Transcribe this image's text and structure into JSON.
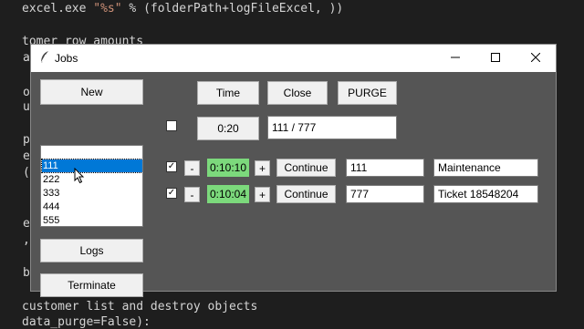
{
  "editor": {
    "line1_pre": "excel.exe ",
    "line1_str": "\"%s\"",
    "line1_post": " % (folderPath+logFileExcel, ))",
    "line2": "tomer row amounts",
    "line3": "customer list and destroy objects",
    "line4": "data_purge=False):",
    "gutter": [
      "a",
      "o",
      "u",
      "p",
      "e",
      "(",
      "e",
      ",",
      "b"
    ]
  },
  "window": {
    "title": "Jobs",
    "icon": "feather-icon",
    "controls": [
      "minimize-icon",
      "maximize-icon",
      "close-icon"
    ]
  },
  "toolbar": {
    "new_label": "New",
    "time_label": "Time",
    "close_label": "Close",
    "purge_label": "PURGE",
    "logs_label": "Logs",
    "terminate_label": "Terminate"
  },
  "listbox": {
    "items": [
      "111",
      "222",
      "333",
      "444",
      "555"
    ],
    "selected": "111"
  },
  "header_row": {
    "checked": false,
    "timer": "0:20",
    "progress_text": "111 / 777"
  },
  "jobs": [
    {
      "checked": true,
      "minus": "-",
      "timer": "0:10:10",
      "plus": "+",
      "continue_label": "Continue",
      "id": "111",
      "description": "Maintenance"
    },
    {
      "checked": true,
      "minus": "-",
      "timer": "0:10:04",
      "plus": "+",
      "continue_label": "Continue",
      "id": "777",
      "description": "Ticket 18548204"
    }
  ],
  "colors": {
    "client_bg": "#555555",
    "timer_active": "#7cd97c",
    "selection": "#0078d7"
  }
}
